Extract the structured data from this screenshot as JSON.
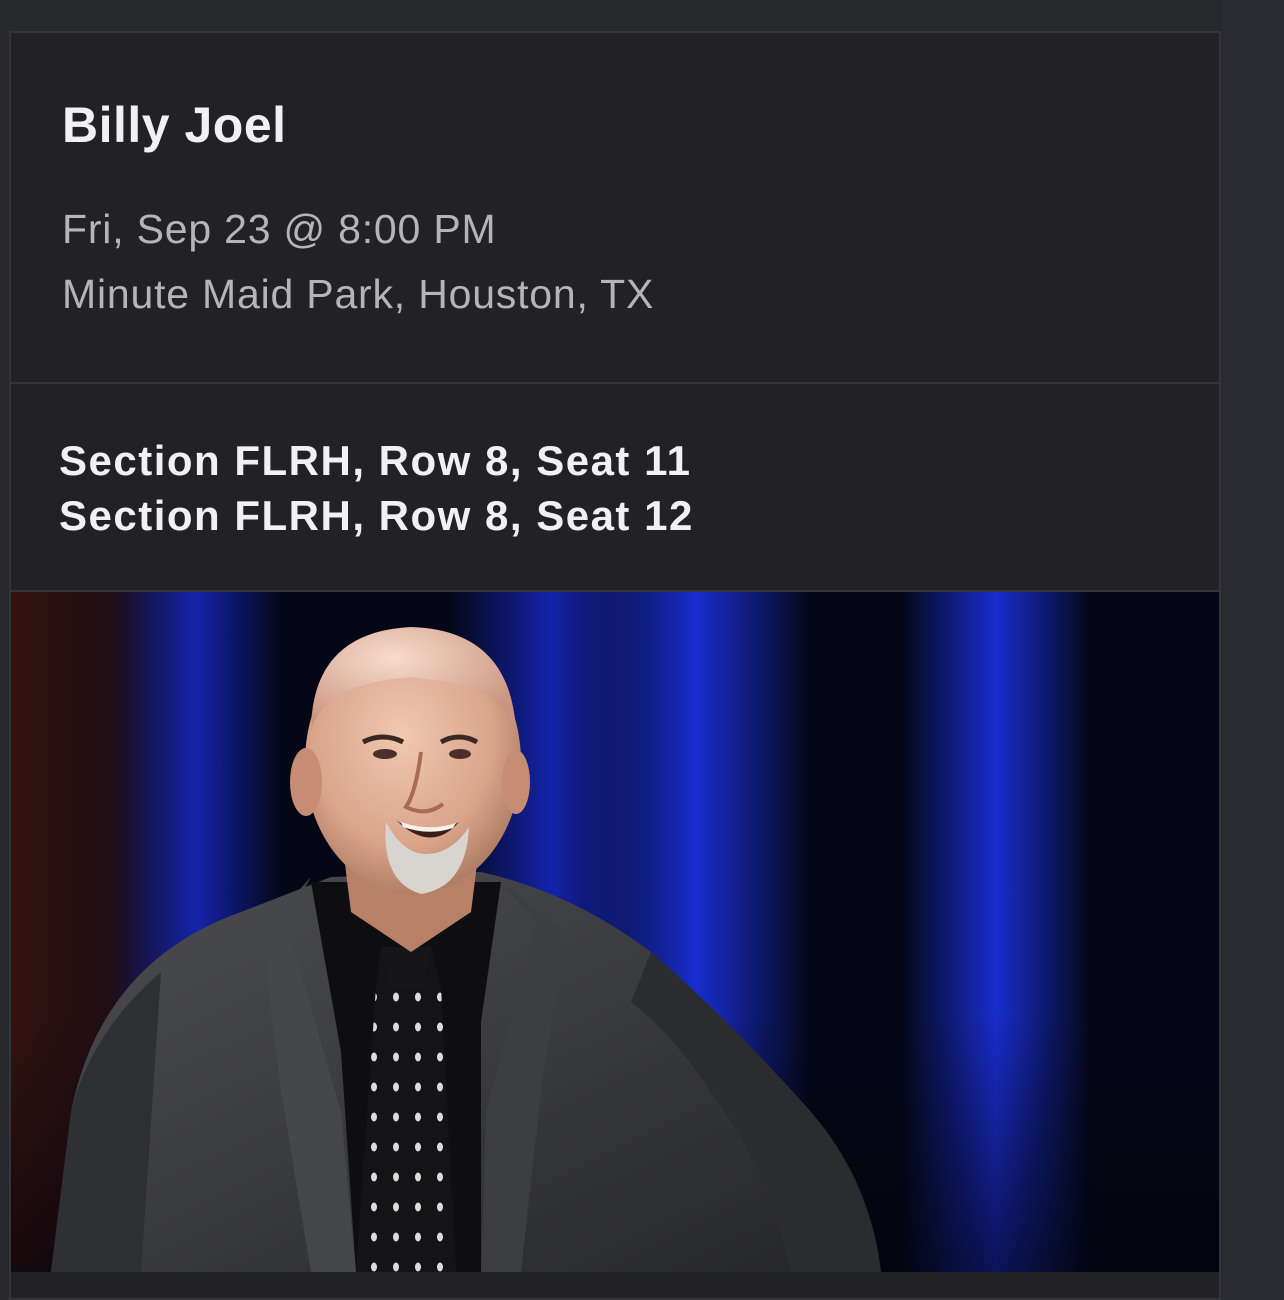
{
  "event": {
    "artist": "Billy Joel",
    "datetime": "Fri, Sep 23 @ 8:00 PM",
    "venue": "Minute Maid Park, Houston, TX"
  },
  "tickets": [
    "Section FLRH, Row 8, Seat 11",
    "Section FLRH, Row 8, Seat 12"
  ],
  "theme": {
    "background": "#27282c",
    "card": "#222225",
    "title_color": "#f1f1f3",
    "subtext_color": "#b4b5ba",
    "stage_light": "#1a2fd8"
  }
}
